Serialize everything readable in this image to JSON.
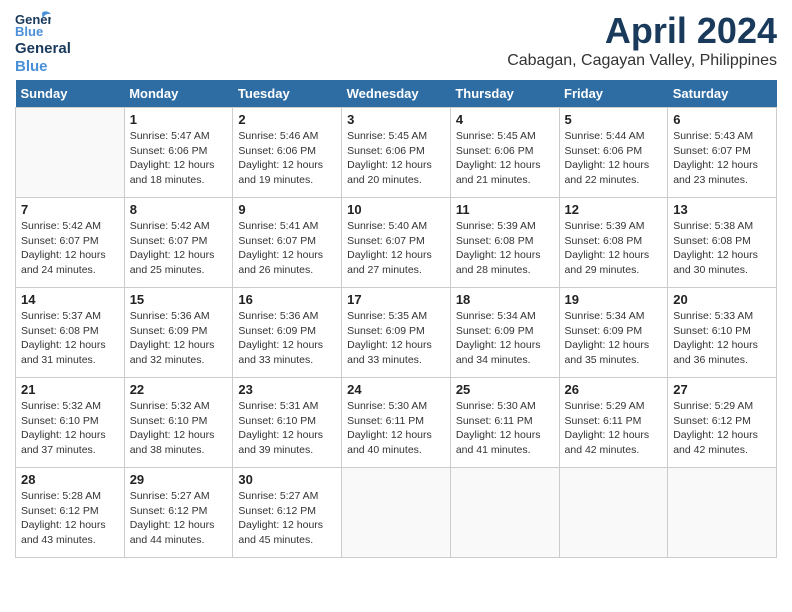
{
  "logo": {
    "general": "General",
    "blue": "Blue"
  },
  "title": "April 2024",
  "subtitle": "Cabagan, Cagayan Valley, Philippines",
  "weekdays": [
    "Sunday",
    "Monday",
    "Tuesday",
    "Wednesday",
    "Thursday",
    "Friday",
    "Saturday"
  ],
  "weeks": [
    [
      {
        "day": "",
        "info": ""
      },
      {
        "day": "1",
        "info": "Sunrise: 5:47 AM\nSunset: 6:06 PM\nDaylight: 12 hours\nand 18 minutes."
      },
      {
        "day": "2",
        "info": "Sunrise: 5:46 AM\nSunset: 6:06 PM\nDaylight: 12 hours\nand 19 minutes."
      },
      {
        "day": "3",
        "info": "Sunrise: 5:45 AM\nSunset: 6:06 PM\nDaylight: 12 hours\nand 20 minutes."
      },
      {
        "day": "4",
        "info": "Sunrise: 5:45 AM\nSunset: 6:06 PM\nDaylight: 12 hours\nand 21 minutes."
      },
      {
        "day": "5",
        "info": "Sunrise: 5:44 AM\nSunset: 6:06 PM\nDaylight: 12 hours\nand 22 minutes."
      },
      {
        "day": "6",
        "info": "Sunrise: 5:43 AM\nSunset: 6:07 PM\nDaylight: 12 hours\nand 23 minutes."
      }
    ],
    [
      {
        "day": "7",
        "info": "Sunrise: 5:42 AM\nSunset: 6:07 PM\nDaylight: 12 hours\nand 24 minutes."
      },
      {
        "day": "8",
        "info": "Sunrise: 5:42 AM\nSunset: 6:07 PM\nDaylight: 12 hours\nand 25 minutes."
      },
      {
        "day": "9",
        "info": "Sunrise: 5:41 AM\nSunset: 6:07 PM\nDaylight: 12 hours\nand 26 minutes."
      },
      {
        "day": "10",
        "info": "Sunrise: 5:40 AM\nSunset: 6:07 PM\nDaylight: 12 hours\nand 27 minutes."
      },
      {
        "day": "11",
        "info": "Sunrise: 5:39 AM\nSunset: 6:08 PM\nDaylight: 12 hours\nand 28 minutes."
      },
      {
        "day": "12",
        "info": "Sunrise: 5:39 AM\nSunset: 6:08 PM\nDaylight: 12 hours\nand 29 minutes."
      },
      {
        "day": "13",
        "info": "Sunrise: 5:38 AM\nSunset: 6:08 PM\nDaylight: 12 hours\nand 30 minutes."
      }
    ],
    [
      {
        "day": "14",
        "info": "Sunrise: 5:37 AM\nSunset: 6:08 PM\nDaylight: 12 hours\nand 31 minutes."
      },
      {
        "day": "15",
        "info": "Sunrise: 5:36 AM\nSunset: 6:09 PM\nDaylight: 12 hours\nand 32 minutes."
      },
      {
        "day": "16",
        "info": "Sunrise: 5:36 AM\nSunset: 6:09 PM\nDaylight: 12 hours\nand 33 minutes."
      },
      {
        "day": "17",
        "info": "Sunrise: 5:35 AM\nSunset: 6:09 PM\nDaylight: 12 hours\nand 33 minutes."
      },
      {
        "day": "18",
        "info": "Sunrise: 5:34 AM\nSunset: 6:09 PM\nDaylight: 12 hours\nand 34 minutes."
      },
      {
        "day": "19",
        "info": "Sunrise: 5:34 AM\nSunset: 6:09 PM\nDaylight: 12 hours\nand 35 minutes."
      },
      {
        "day": "20",
        "info": "Sunrise: 5:33 AM\nSunset: 6:10 PM\nDaylight: 12 hours\nand 36 minutes."
      }
    ],
    [
      {
        "day": "21",
        "info": "Sunrise: 5:32 AM\nSunset: 6:10 PM\nDaylight: 12 hours\nand 37 minutes."
      },
      {
        "day": "22",
        "info": "Sunrise: 5:32 AM\nSunset: 6:10 PM\nDaylight: 12 hours\nand 38 minutes."
      },
      {
        "day": "23",
        "info": "Sunrise: 5:31 AM\nSunset: 6:10 PM\nDaylight: 12 hours\nand 39 minutes."
      },
      {
        "day": "24",
        "info": "Sunrise: 5:30 AM\nSunset: 6:11 PM\nDaylight: 12 hours\nand 40 minutes."
      },
      {
        "day": "25",
        "info": "Sunrise: 5:30 AM\nSunset: 6:11 PM\nDaylight: 12 hours\nand 41 minutes."
      },
      {
        "day": "26",
        "info": "Sunrise: 5:29 AM\nSunset: 6:11 PM\nDaylight: 12 hours\nand 42 minutes."
      },
      {
        "day": "27",
        "info": "Sunrise: 5:29 AM\nSunset: 6:12 PM\nDaylight: 12 hours\nand 42 minutes."
      }
    ],
    [
      {
        "day": "28",
        "info": "Sunrise: 5:28 AM\nSunset: 6:12 PM\nDaylight: 12 hours\nand 43 minutes."
      },
      {
        "day": "29",
        "info": "Sunrise: 5:27 AM\nSunset: 6:12 PM\nDaylight: 12 hours\nand 44 minutes."
      },
      {
        "day": "30",
        "info": "Sunrise: 5:27 AM\nSunset: 6:12 PM\nDaylight: 12 hours\nand 45 minutes."
      },
      {
        "day": "",
        "info": ""
      },
      {
        "day": "",
        "info": ""
      },
      {
        "day": "",
        "info": ""
      },
      {
        "day": "",
        "info": ""
      }
    ]
  ]
}
